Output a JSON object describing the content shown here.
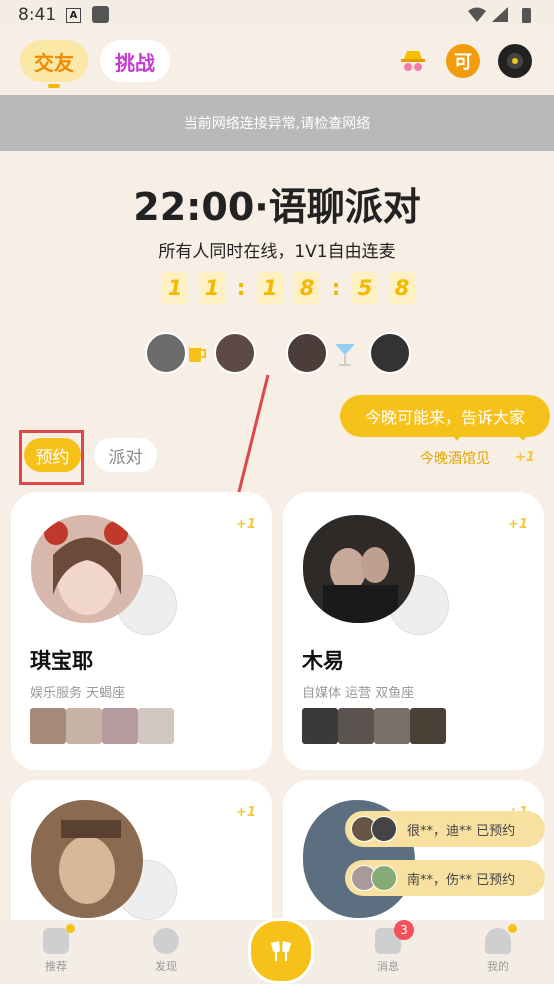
{
  "status_bar": {
    "time": "8:41",
    "a_icon": "A"
  },
  "header": {
    "tabs": [
      {
        "label": "交友"
      },
      {
        "label": "挑战"
      }
    ],
    "icons": [
      "hat-glasses-icon",
      "coin-icon",
      "record-player-icon"
    ],
    "coin_label": "可"
  },
  "banner": {
    "text": "当前网络连接异常,请检查网络"
  },
  "hero": {
    "title": "22:00·语聊派对",
    "subtitle": "所有人同时在线，1V1自由连麦",
    "countdown": {
      "h1": "1",
      "h2": "1",
      "m1": "1",
      "m2": "8",
      "s1": "5",
      "s2": "8"
    }
  },
  "segment": {
    "active": "预约",
    "inactive": "派对"
  },
  "bubble": {
    "text": "今晚可能来，告诉大家",
    "sub": "今晚酒馆见",
    "plus": "+1"
  },
  "cards": [
    {
      "name": "琪宝耶",
      "tags": "娱乐服务  天蝎座",
      "plus": "+1"
    },
    {
      "name": "木易",
      "tags": "自媒体  运营  双鱼座",
      "plus": "+1"
    },
    {
      "plus": "+1"
    },
    {
      "plus": "+1"
    }
  ],
  "notices": [
    {
      "text": "很**，迪** 已预约"
    },
    {
      "text": "南**，伤** 已预约"
    }
  ],
  "nav": {
    "items": [
      {
        "label": "推荐"
      },
      {
        "label": "发现"
      },
      {
        "label": "消息"
      },
      {
        "label": "我的"
      }
    ],
    "badge": "3"
  },
  "colors": {
    "accent": "#f6c21a",
    "background": "#f7efe6",
    "highlight_box": "#e0454a",
    "banner": "#b9b9b9"
  }
}
